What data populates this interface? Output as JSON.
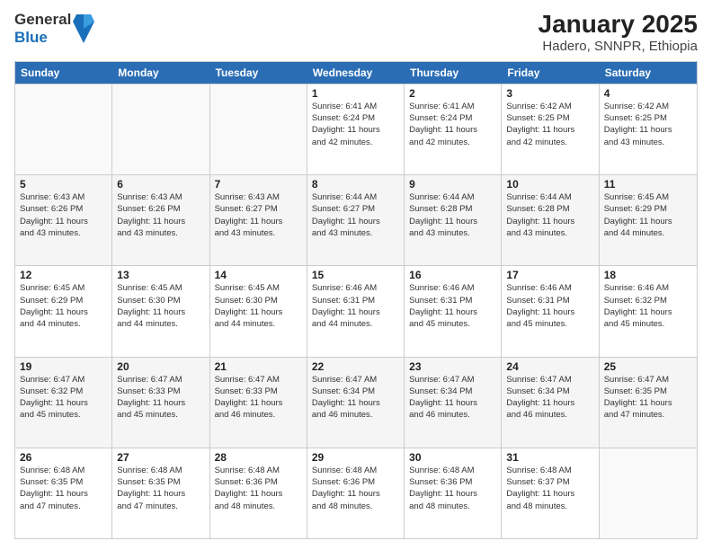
{
  "header": {
    "logo": {
      "line1": "General",
      "line2": "Blue"
    },
    "title": "January 2025",
    "subtitle": "Hadero, SNNPR, Ethiopia"
  },
  "days_of_week": [
    "Sunday",
    "Monday",
    "Tuesday",
    "Wednesday",
    "Thursday",
    "Friday",
    "Saturday"
  ],
  "weeks": [
    {
      "shaded": false,
      "cells": [
        {
          "day": "",
          "info": ""
        },
        {
          "day": "",
          "info": ""
        },
        {
          "day": "",
          "info": ""
        },
        {
          "day": "1",
          "info": "Sunrise: 6:41 AM\nSunset: 6:24 PM\nDaylight: 11 hours\nand 42 minutes."
        },
        {
          "day": "2",
          "info": "Sunrise: 6:41 AM\nSunset: 6:24 PM\nDaylight: 11 hours\nand 42 minutes."
        },
        {
          "day": "3",
          "info": "Sunrise: 6:42 AM\nSunset: 6:25 PM\nDaylight: 11 hours\nand 42 minutes."
        },
        {
          "day": "4",
          "info": "Sunrise: 6:42 AM\nSunset: 6:25 PM\nDaylight: 11 hours\nand 43 minutes."
        }
      ]
    },
    {
      "shaded": true,
      "cells": [
        {
          "day": "5",
          "info": "Sunrise: 6:43 AM\nSunset: 6:26 PM\nDaylight: 11 hours\nand 43 minutes."
        },
        {
          "day": "6",
          "info": "Sunrise: 6:43 AM\nSunset: 6:26 PM\nDaylight: 11 hours\nand 43 minutes."
        },
        {
          "day": "7",
          "info": "Sunrise: 6:43 AM\nSunset: 6:27 PM\nDaylight: 11 hours\nand 43 minutes."
        },
        {
          "day": "8",
          "info": "Sunrise: 6:44 AM\nSunset: 6:27 PM\nDaylight: 11 hours\nand 43 minutes."
        },
        {
          "day": "9",
          "info": "Sunrise: 6:44 AM\nSunset: 6:28 PM\nDaylight: 11 hours\nand 43 minutes."
        },
        {
          "day": "10",
          "info": "Sunrise: 6:44 AM\nSunset: 6:28 PM\nDaylight: 11 hours\nand 43 minutes."
        },
        {
          "day": "11",
          "info": "Sunrise: 6:45 AM\nSunset: 6:29 PM\nDaylight: 11 hours\nand 44 minutes."
        }
      ]
    },
    {
      "shaded": false,
      "cells": [
        {
          "day": "12",
          "info": "Sunrise: 6:45 AM\nSunset: 6:29 PM\nDaylight: 11 hours\nand 44 minutes."
        },
        {
          "day": "13",
          "info": "Sunrise: 6:45 AM\nSunset: 6:30 PM\nDaylight: 11 hours\nand 44 minutes."
        },
        {
          "day": "14",
          "info": "Sunrise: 6:45 AM\nSunset: 6:30 PM\nDaylight: 11 hours\nand 44 minutes."
        },
        {
          "day": "15",
          "info": "Sunrise: 6:46 AM\nSunset: 6:31 PM\nDaylight: 11 hours\nand 44 minutes."
        },
        {
          "day": "16",
          "info": "Sunrise: 6:46 AM\nSunset: 6:31 PM\nDaylight: 11 hours\nand 45 minutes."
        },
        {
          "day": "17",
          "info": "Sunrise: 6:46 AM\nSunset: 6:31 PM\nDaylight: 11 hours\nand 45 minutes."
        },
        {
          "day": "18",
          "info": "Sunrise: 6:46 AM\nSunset: 6:32 PM\nDaylight: 11 hours\nand 45 minutes."
        }
      ]
    },
    {
      "shaded": true,
      "cells": [
        {
          "day": "19",
          "info": "Sunrise: 6:47 AM\nSunset: 6:32 PM\nDaylight: 11 hours\nand 45 minutes."
        },
        {
          "day": "20",
          "info": "Sunrise: 6:47 AM\nSunset: 6:33 PM\nDaylight: 11 hours\nand 45 minutes."
        },
        {
          "day": "21",
          "info": "Sunrise: 6:47 AM\nSunset: 6:33 PM\nDaylight: 11 hours\nand 46 minutes."
        },
        {
          "day": "22",
          "info": "Sunrise: 6:47 AM\nSunset: 6:34 PM\nDaylight: 11 hours\nand 46 minutes."
        },
        {
          "day": "23",
          "info": "Sunrise: 6:47 AM\nSunset: 6:34 PM\nDaylight: 11 hours\nand 46 minutes."
        },
        {
          "day": "24",
          "info": "Sunrise: 6:47 AM\nSunset: 6:34 PM\nDaylight: 11 hours\nand 46 minutes."
        },
        {
          "day": "25",
          "info": "Sunrise: 6:47 AM\nSunset: 6:35 PM\nDaylight: 11 hours\nand 47 minutes."
        }
      ]
    },
    {
      "shaded": false,
      "cells": [
        {
          "day": "26",
          "info": "Sunrise: 6:48 AM\nSunset: 6:35 PM\nDaylight: 11 hours\nand 47 minutes."
        },
        {
          "day": "27",
          "info": "Sunrise: 6:48 AM\nSunset: 6:35 PM\nDaylight: 11 hours\nand 47 minutes."
        },
        {
          "day": "28",
          "info": "Sunrise: 6:48 AM\nSunset: 6:36 PM\nDaylight: 11 hours\nand 48 minutes."
        },
        {
          "day": "29",
          "info": "Sunrise: 6:48 AM\nSunset: 6:36 PM\nDaylight: 11 hours\nand 48 minutes."
        },
        {
          "day": "30",
          "info": "Sunrise: 6:48 AM\nSunset: 6:36 PM\nDaylight: 11 hours\nand 48 minutes."
        },
        {
          "day": "31",
          "info": "Sunrise: 6:48 AM\nSunset: 6:37 PM\nDaylight: 11 hours\nand 48 minutes."
        },
        {
          "day": "",
          "info": ""
        }
      ]
    }
  ]
}
